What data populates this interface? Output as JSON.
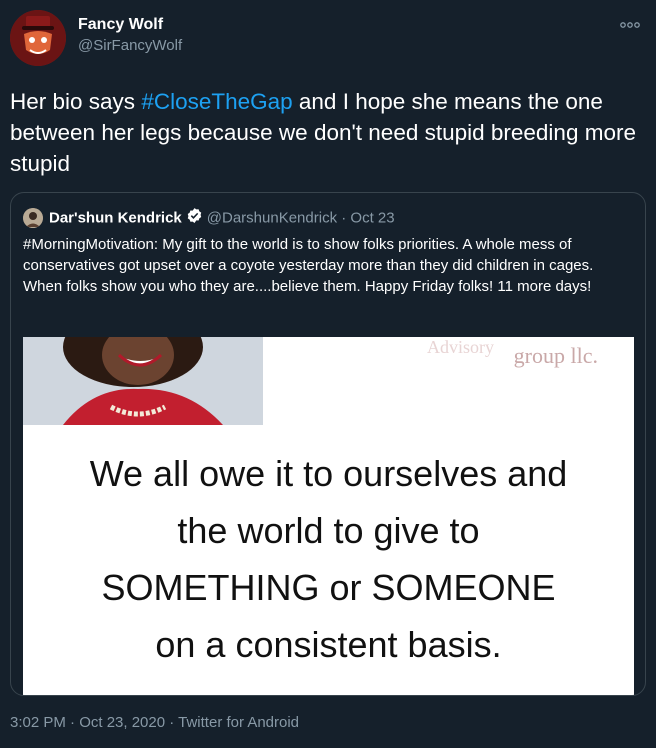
{
  "tweet": {
    "display_name": "Fancy Wolf",
    "handle": "@SirFancyWolf",
    "text_before": "Her bio says ",
    "hashtag": "#CloseTheGap",
    "text_after": " and I hope she means the one between her legs because we don't need stupid breeding more stupid",
    "more_icon": "more-icon",
    "footer": "3:02 PM · Oct 23, 2020 · Twitter for Android"
  },
  "quote": {
    "name": "Dar'shun Kendrick",
    "handle": "@DarshunKendrick",
    "separator": " · ",
    "date": "Oct 23",
    "verified_icon": "verified-badge-icon",
    "text": "#MorningMotivation: My gift to the world is to show folks priorities. A whole mess of conservatives got upset over a coyote yesterday more than they did children in cages. When folks show you who they are....believe them. Happy Friday folks! 11 more days!",
    "image": {
      "brand_top": "Advisory",
      "brand_bottom": "group llc.",
      "line1": "We all owe it to ourselves and",
      "line2": "the world to give to",
      "line3": "SOMETHING or SOMEONE",
      "line4": "on a consistent basis."
    }
  },
  "colors": {
    "background": "#15202b",
    "accent": "#1da1f2",
    "secondary_text": "#8899a6",
    "border": "#38444d"
  }
}
